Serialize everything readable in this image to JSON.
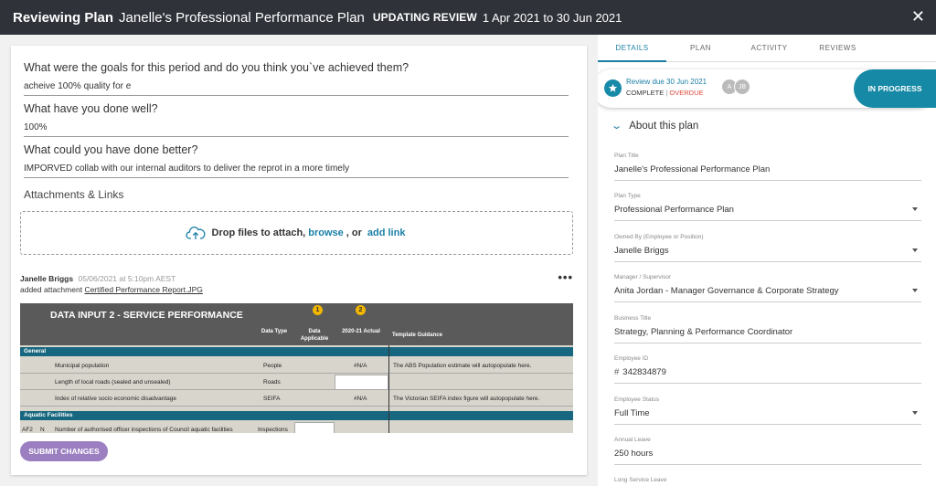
{
  "header": {
    "mode": "Reviewing Plan",
    "plan_title": "Janelle's Professional Performance Plan",
    "status": "UPDATING REVIEW",
    "dates": "1 Apr 2021 to 30 Jun 2021",
    "close_icon": "close-icon"
  },
  "questions": [
    {
      "label": "What were the goals for this period and do you think you`ve achieved them?",
      "answer": "acheive 100% quality for e"
    },
    {
      "label": "What have you done well?",
      "answer": "100%"
    },
    {
      "label": "What could you have done better?",
      "answer": "IMPORVED collab with our internal auditors to deliver the reprot in a more timely"
    }
  ],
  "attachments": {
    "title": "Attachments & Links",
    "drop_text": "Drop files to attach,",
    "browse": "browse",
    "or": ", or",
    "add_link": "add link",
    "icon": "cloud-upload-icon"
  },
  "activity": {
    "author": "Janelle Briggs",
    "timestamp": "05/06/2021 at 5:10pm AEST",
    "action": "added attachment",
    "file": "Certified Performance Report.JPG",
    "more": "•••"
  },
  "attachment_image": {
    "title": "DATA INPUT 2 - SERVICE PERFORMANCE",
    "columns": [
      "Data Type",
      "Data Applicable",
      "2020-21 Actual",
      "Template Guidance"
    ],
    "badges": [
      "1",
      "2"
    ],
    "sections": [
      "General",
      "Aquatic Facilities"
    ],
    "rows": [
      {
        "name": "Municipal population",
        "type": "People",
        "actual": "#N/A",
        "guidance": "The ABS Population estimate will autopopulate here."
      },
      {
        "name": "Length of local roads (sealed and unsealed)",
        "type": "Roads",
        "actual": "",
        "guidance": ""
      },
      {
        "name": "Index of relative socio economic disadvantage",
        "type": "SEIFA",
        "actual": "#N/A",
        "guidance": "The Victorian SEIFA index figure will autopopulate here."
      },
      {
        "code": "AF2",
        "sub": "N",
        "name": "Number of authorised officer inspections of Council aquatic facilities",
        "type": "Inspections",
        "actual": "",
        "guidance": ""
      }
    ]
  },
  "submit_label": "SUBMIT CHANGES",
  "right_panel": {
    "tabs": [
      "DETAILS",
      "PLAN",
      "ACTIVITY",
      "REVIEWS"
    ],
    "active_tab": "DETAILS",
    "review_due": "Review due 30 Jun 2021",
    "complete": "COMPLETE",
    "separator": "|",
    "overdue": "OVERDUE",
    "avatars": [
      "A",
      "JB"
    ],
    "status_button": "IN PROGRESS",
    "about_label": "About this plan",
    "fields": [
      {
        "label": "Plan Title",
        "value": "Janelle's Professional Performance Plan",
        "dropdown": false
      },
      {
        "label": "Plan Type",
        "value": "Professional Performance Plan",
        "dropdown": true
      },
      {
        "label": "Owned By (Employee or Position)",
        "value": "Janelle Briggs",
        "dropdown": true
      },
      {
        "label": "Manager / Supervisor",
        "value": "Anita Jordan - Manager Governance & Corporate Strategy",
        "dropdown": true
      },
      {
        "label": "Business Title",
        "value": "Strategy, Planning & Performance Coordinator",
        "dropdown": false
      },
      {
        "label": "Employee ID",
        "prefix": "#",
        "value": "342834879",
        "dropdown": false
      },
      {
        "label": "Employee Status",
        "value": "Full Time",
        "dropdown": true
      },
      {
        "label": "Annual Leave",
        "value": "250 hours",
        "dropdown": false
      },
      {
        "label": "Long Service Leave",
        "value": "",
        "dropdown": false
      }
    ]
  },
  "colors": {
    "header_bg": "#2f3239",
    "accent": "#1a7fa6",
    "status_button": "#1589a6",
    "submit": "#9b7fc0",
    "overdue": "#e04a3a",
    "sheet_section": "#16677f",
    "badge": "#f2b600"
  }
}
